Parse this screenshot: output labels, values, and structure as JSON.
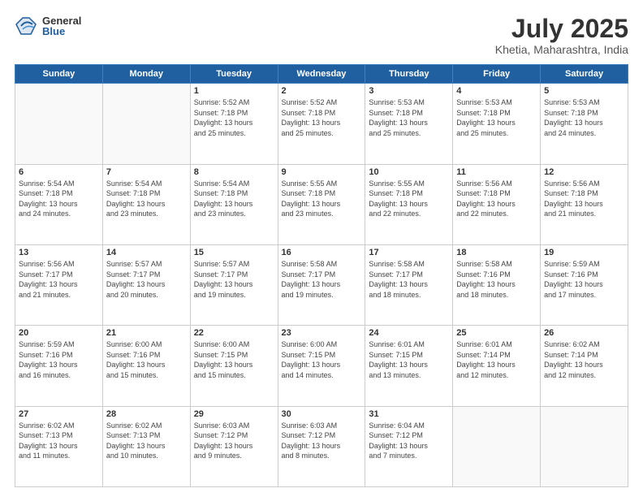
{
  "header": {
    "logo_general": "General",
    "logo_blue": "Blue",
    "month_title": "July 2025",
    "location": "Khetia, Maharashtra, India"
  },
  "weekdays": [
    "Sunday",
    "Monday",
    "Tuesday",
    "Wednesday",
    "Thursday",
    "Friday",
    "Saturday"
  ],
  "weeks": [
    [
      {
        "day": "",
        "info": ""
      },
      {
        "day": "",
        "info": ""
      },
      {
        "day": "1",
        "info": "Sunrise: 5:52 AM\nSunset: 7:18 PM\nDaylight: 13 hours\nand 25 minutes."
      },
      {
        "day": "2",
        "info": "Sunrise: 5:52 AM\nSunset: 7:18 PM\nDaylight: 13 hours\nand 25 minutes."
      },
      {
        "day": "3",
        "info": "Sunrise: 5:53 AM\nSunset: 7:18 PM\nDaylight: 13 hours\nand 25 minutes."
      },
      {
        "day": "4",
        "info": "Sunrise: 5:53 AM\nSunset: 7:18 PM\nDaylight: 13 hours\nand 25 minutes."
      },
      {
        "day": "5",
        "info": "Sunrise: 5:53 AM\nSunset: 7:18 PM\nDaylight: 13 hours\nand 24 minutes."
      }
    ],
    [
      {
        "day": "6",
        "info": "Sunrise: 5:54 AM\nSunset: 7:18 PM\nDaylight: 13 hours\nand 24 minutes."
      },
      {
        "day": "7",
        "info": "Sunrise: 5:54 AM\nSunset: 7:18 PM\nDaylight: 13 hours\nand 23 minutes."
      },
      {
        "day": "8",
        "info": "Sunrise: 5:54 AM\nSunset: 7:18 PM\nDaylight: 13 hours\nand 23 minutes."
      },
      {
        "day": "9",
        "info": "Sunrise: 5:55 AM\nSunset: 7:18 PM\nDaylight: 13 hours\nand 23 minutes."
      },
      {
        "day": "10",
        "info": "Sunrise: 5:55 AM\nSunset: 7:18 PM\nDaylight: 13 hours\nand 22 minutes."
      },
      {
        "day": "11",
        "info": "Sunrise: 5:56 AM\nSunset: 7:18 PM\nDaylight: 13 hours\nand 22 minutes."
      },
      {
        "day": "12",
        "info": "Sunrise: 5:56 AM\nSunset: 7:18 PM\nDaylight: 13 hours\nand 21 minutes."
      }
    ],
    [
      {
        "day": "13",
        "info": "Sunrise: 5:56 AM\nSunset: 7:17 PM\nDaylight: 13 hours\nand 21 minutes."
      },
      {
        "day": "14",
        "info": "Sunrise: 5:57 AM\nSunset: 7:17 PM\nDaylight: 13 hours\nand 20 minutes."
      },
      {
        "day": "15",
        "info": "Sunrise: 5:57 AM\nSunset: 7:17 PM\nDaylight: 13 hours\nand 19 minutes."
      },
      {
        "day": "16",
        "info": "Sunrise: 5:58 AM\nSunset: 7:17 PM\nDaylight: 13 hours\nand 19 minutes."
      },
      {
        "day": "17",
        "info": "Sunrise: 5:58 AM\nSunset: 7:17 PM\nDaylight: 13 hours\nand 18 minutes."
      },
      {
        "day": "18",
        "info": "Sunrise: 5:58 AM\nSunset: 7:16 PM\nDaylight: 13 hours\nand 18 minutes."
      },
      {
        "day": "19",
        "info": "Sunrise: 5:59 AM\nSunset: 7:16 PM\nDaylight: 13 hours\nand 17 minutes."
      }
    ],
    [
      {
        "day": "20",
        "info": "Sunrise: 5:59 AM\nSunset: 7:16 PM\nDaylight: 13 hours\nand 16 minutes."
      },
      {
        "day": "21",
        "info": "Sunrise: 6:00 AM\nSunset: 7:16 PM\nDaylight: 13 hours\nand 15 minutes."
      },
      {
        "day": "22",
        "info": "Sunrise: 6:00 AM\nSunset: 7:15 PM\nDaylight: 13 hours\nand 15 minutes."
      },
      {
        "day": "23",
        "info": "Sunrise: 6:00 AM\nSunset: 7:15 PM\nDaylight: 13 hours\nand 14 minutes."
      },
      {
        "day": "24",
        "info": "Sunrise: 6:01 AM\nSunset: 7:15 PM\nDaylight: 13 hours\nand 13 minutes."
      },
      {
        "day": "25",
        "info": "Sunrise: 6:01 AM\nSunset: 7:14 PM\nDaylight: 13 hours\nand 12 minutes."
      },
      {
        "day": "26",
        "info": "Sunrise: 6:02 AM\nSunset: 7:14 PM\nDaylight: 13 hours\nand 12 minutes."
      }
    ],
    [
      {
        "day": "27",
        "info": "Sunrise: 6:02 AM\nSunset: 7:13 PM\nDaylight: 13 hours\nand 11 minutes."
      },
      {
        "day": "28",
        "info": "Sunrise: 6:02 AM\nSunset: 7:13 PM\nDaylight: 13 hours\nand 10 minutes."
      },
      {
        "day": "29",
        "info": "Sunrise: 6:03 AM\nSunset: 7:12 PM\nDaylight: 13 hours\nand 9 minutes."
      },
      {
        "day": "30",
        "info": "Sunrise: 6:03 AM\nSunset: 7:12 PM\nDaylight: 13 hours\nand 8 minutes."
      },
      {
        "day": "31",
        "info": "Sunrise: 6:04 AM\nSunset: 7:12 PM\nDaylight: 13 hours\nand 7 minutes."
      },
      {
        "day": "",
        "info": ""
      },
      {
        "day": "",
        "info": ""
      }
    ]
  ]
}
